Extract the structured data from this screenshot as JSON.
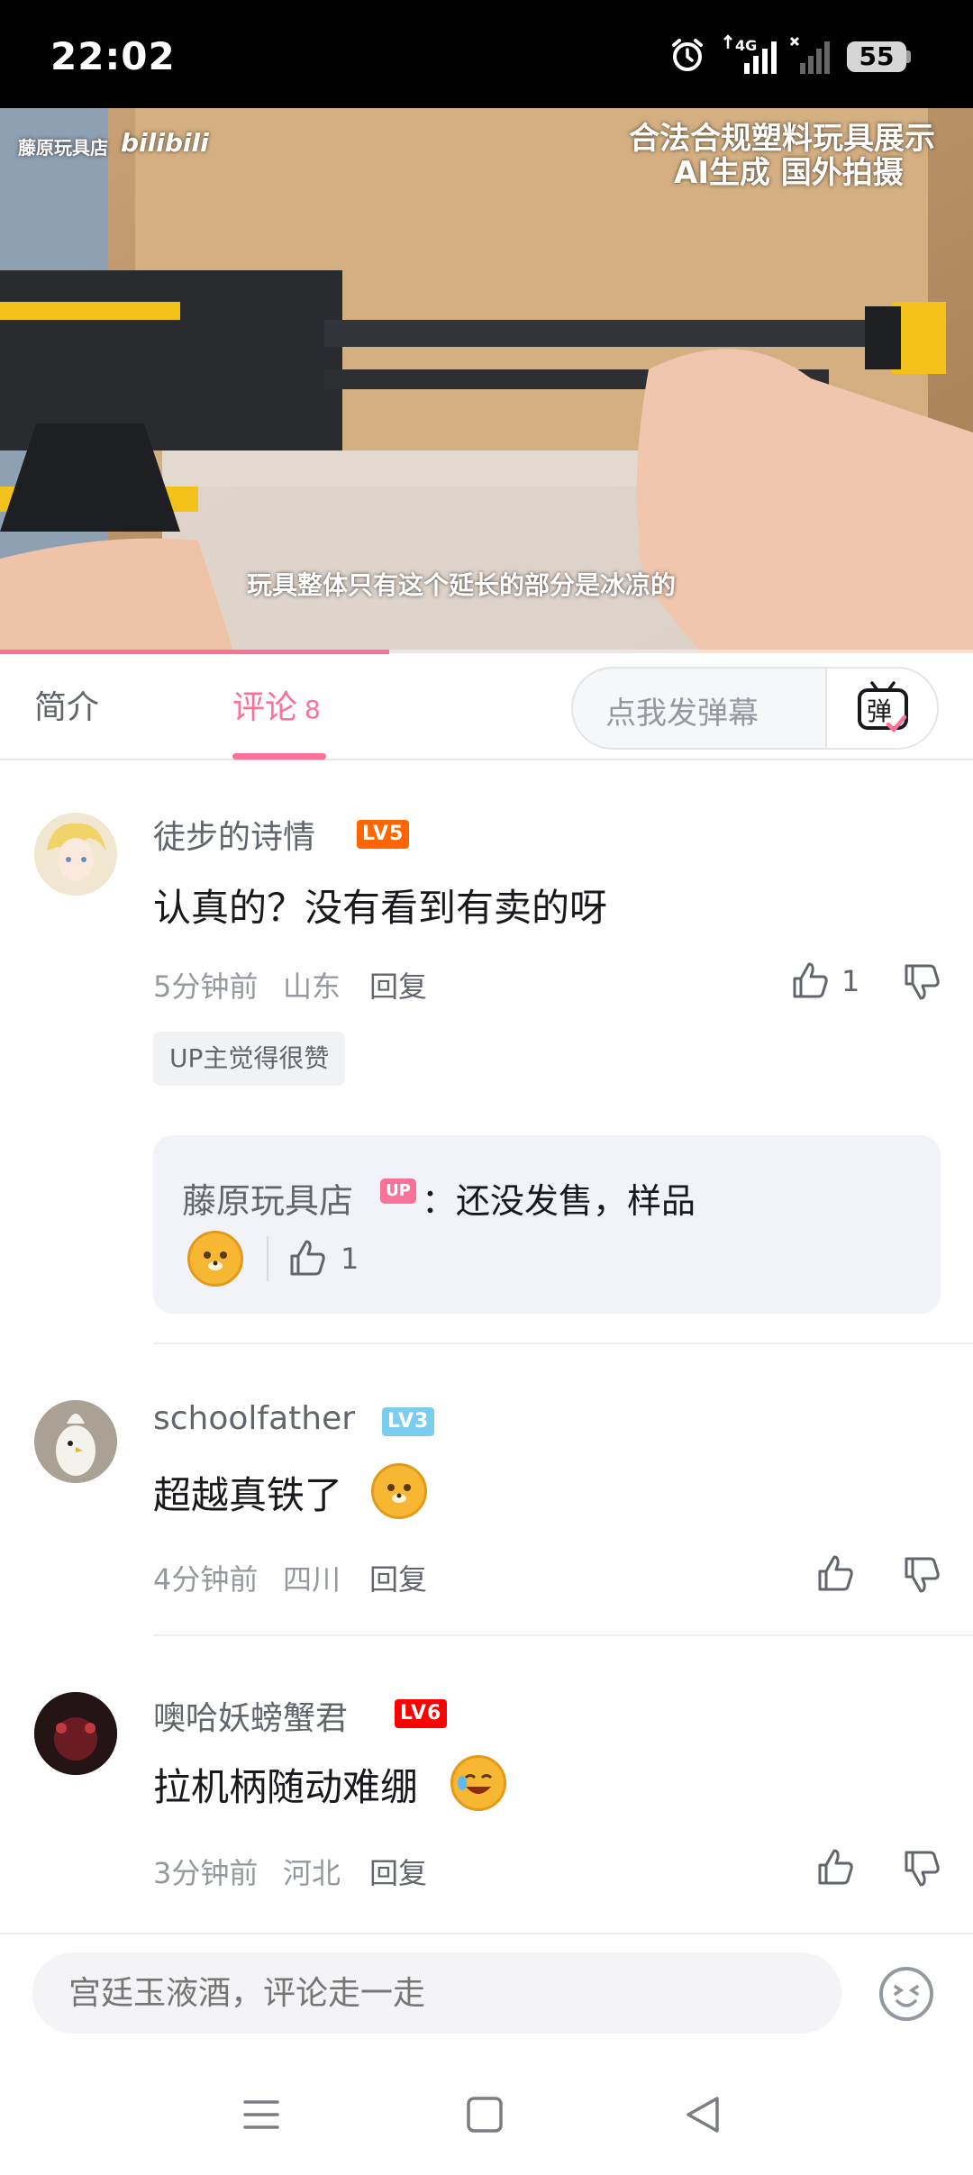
{
  "status_bar": {
    "time": "22:02",
    "network": "4G",
    "battery": "55"
  },
  "video": {
    "watermark_channel": "藤原玩具店",
    "watermark_brand": "bilibili",
    "notice_line1": "合法合规塑料玩具展示",
    "notice_line2": "AI生成 国外拍摄",
    "subtitle": "玩具整体只有这个延长的部分是冰凉的",
    "progress_fraction": 0.4
  },
  "tabs": {
    "intro": "简介",
    "comments": "评论",
    "comments_count": "8"
  },
  "danmaku": {
    "placeholder": "点我发弹幕",
    "button": "弹"
  },
  "comments": [
    {
      "username": "徒步的诗情",
      "level": "LV5",
      "level_color": "#ff6600",
      "text": "认真的？没有看到有卖的呀",
      "time": "5分钟前",
      "location": "山东",
      "reply": "回复",
      "likes": "1",
      "tag": "UP主觉得很赞",
      "sub_reply": {
        "author": "藤原玩具店",
        "badge": "UP",
        "text": "：还没发售，样品",
        "likes": "1"
      }
    },
    {
      "username": "schoolfather",
      "level": "LV3",
      "level_color": "#7bcdef",
      "text": "超越真铁了",
      "time": "4分钟前",
      "location": "四川",
      "reply": "回复"
    },
    {
      "username": "噢哈妖螃蟹君",
      "level": "LV6",
      "level_color": "#ff0000",
      "text": "拉机柄随动难绷",
      "time": "3分钟前",
      "location": "河北",
      "reply": "回复"
    }
  ],
  "input": {
    "placeholder": "宫廷玉液酒，评论走一走"
  },
  "colors": {
    "accent": "#fb7299",
    "text_primary": "#18191c",
    "text_secondary": "#61666d",
    "text_muted": "#9499a0"
  }
}
